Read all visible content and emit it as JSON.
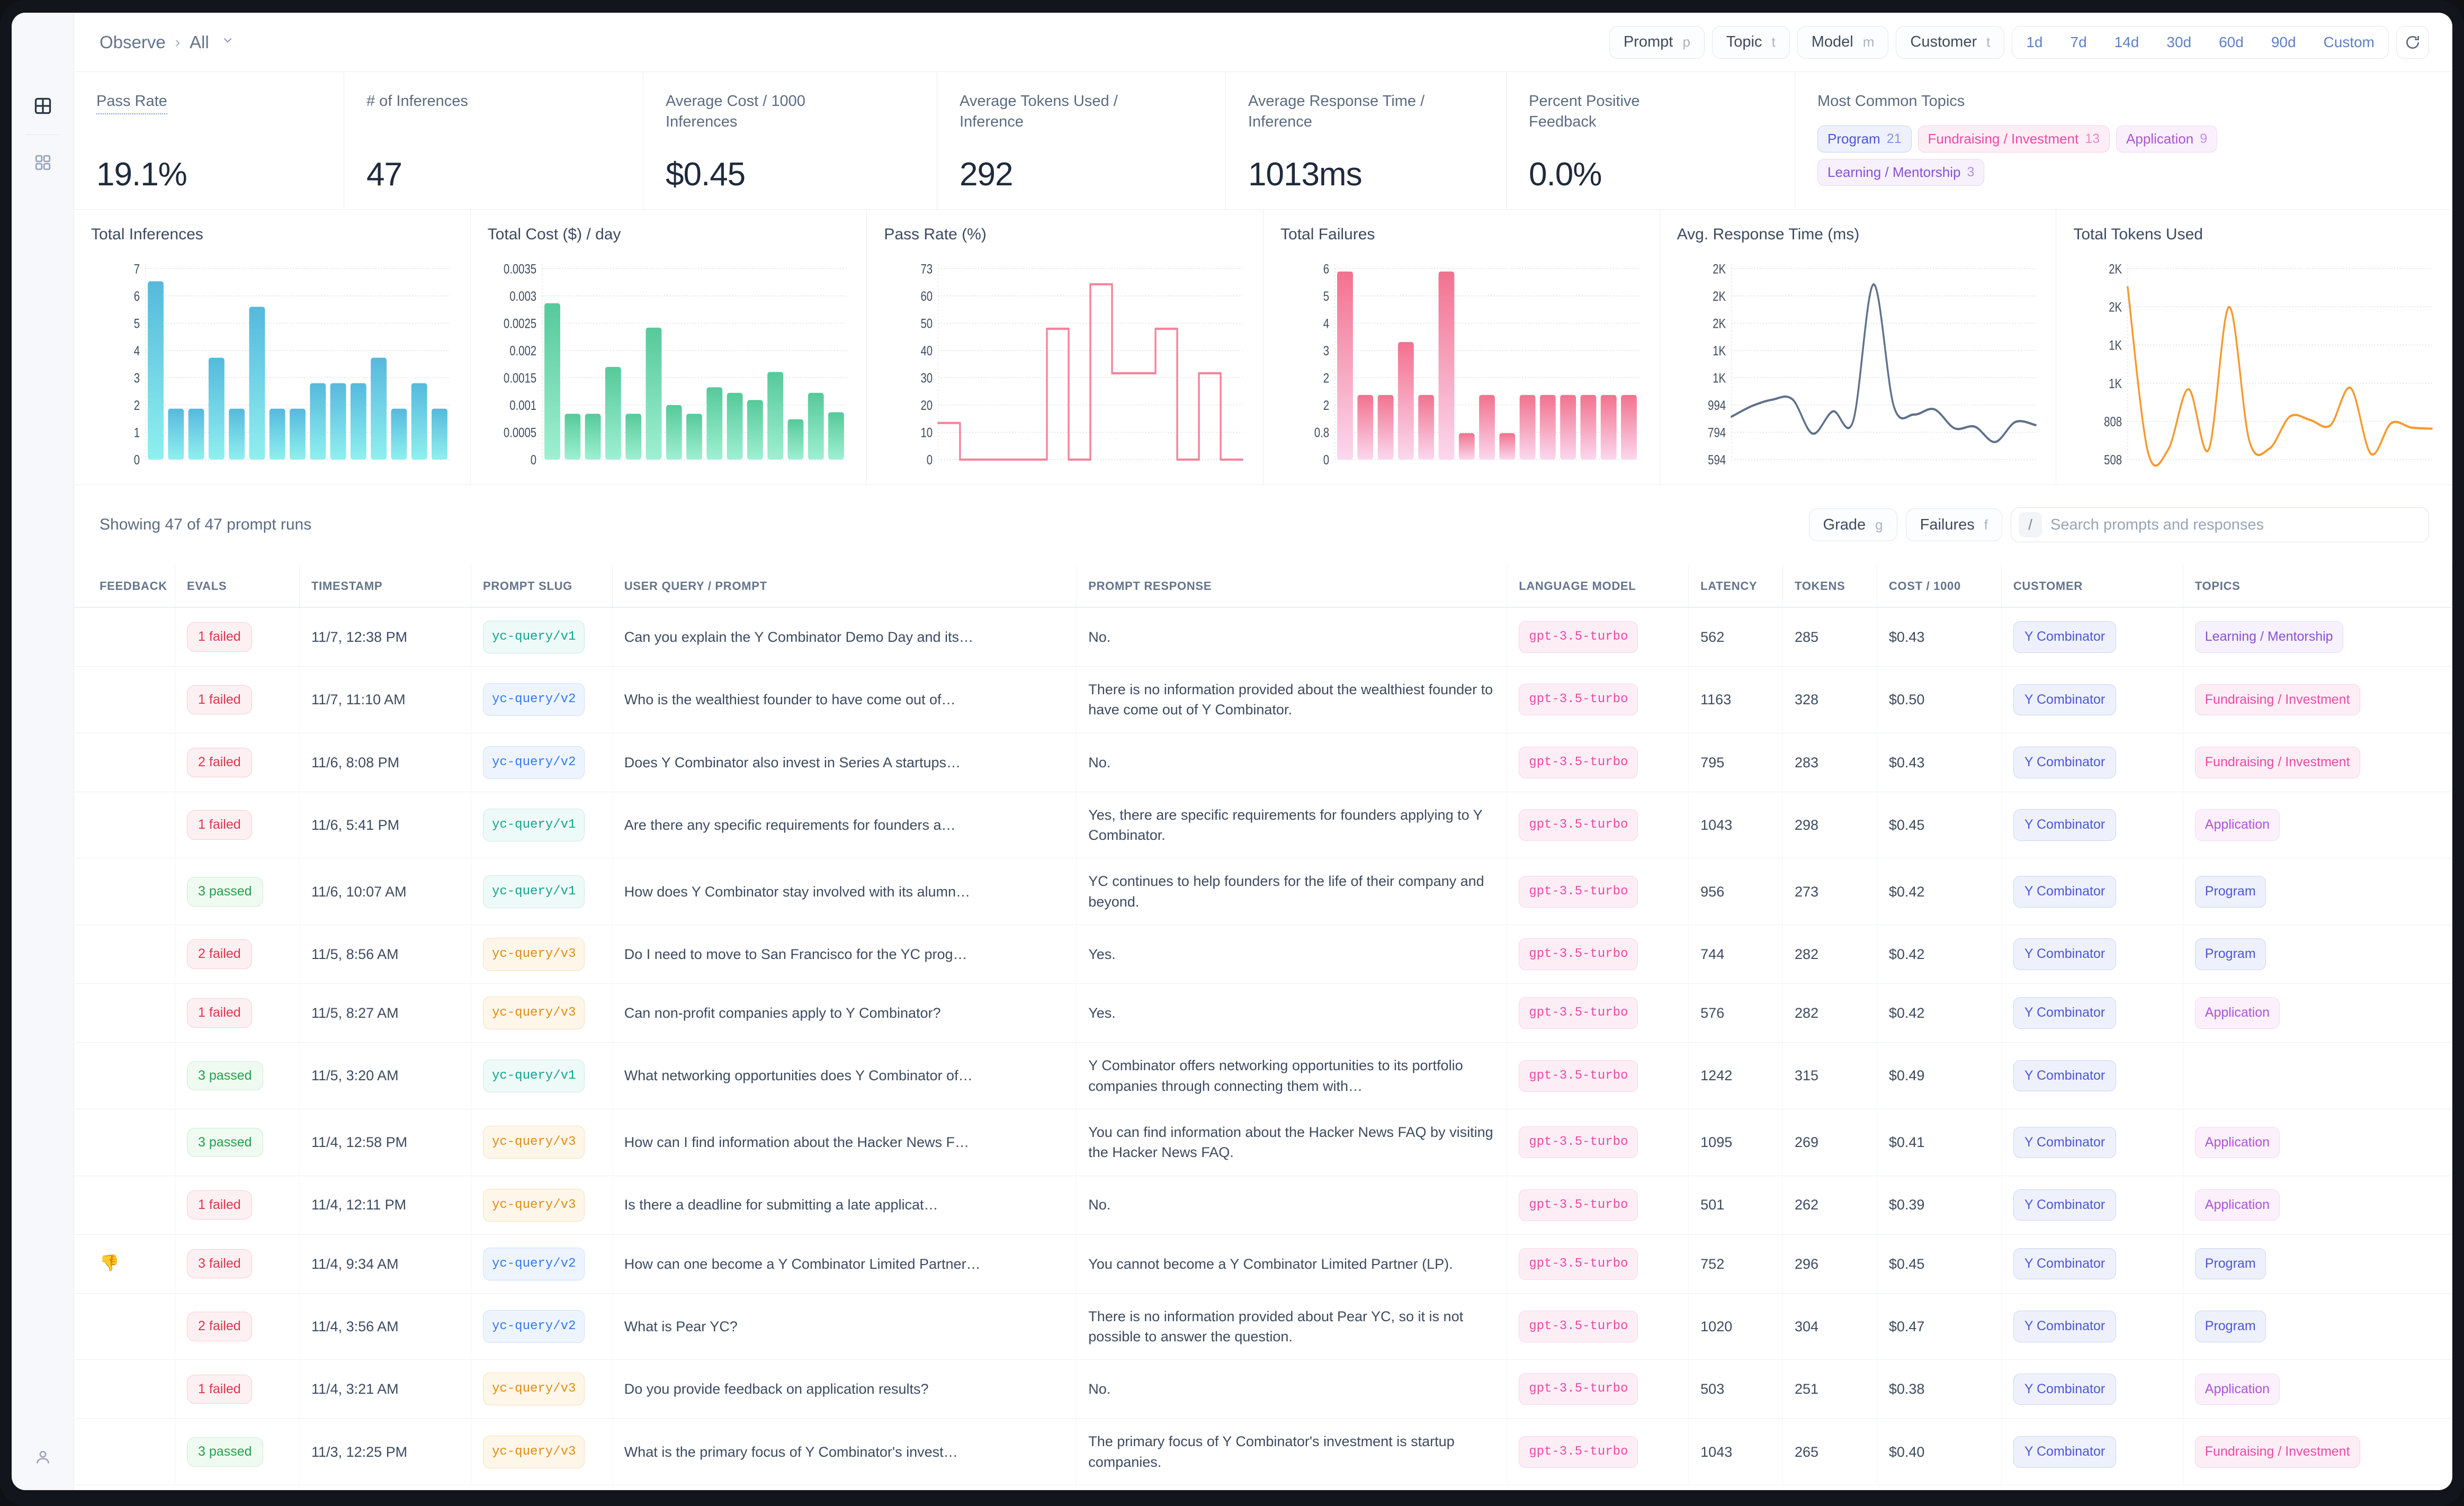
{
  "header": {
    "breadcrumb_root": "Observe",
    "breadcrumb_sep": "›",
    "breadcrumb_current": "All",
    "filters": [
      {
        "label": "Prompt",
        "key": "p"
      },
      {
        "label": "Topic",
        "key": "t"
      },
      {
        "label": "Model",
        "key": "m"
      },
      {
        "label": "Customer",
        "key": "t"
      }
    ],
    "ranges": [
      "1d",
      "7d",
      "14d",
      "30d",
      "60d",
      "90d",
      "Custom"
    ],
    "refresh_icon": "refresh-icon"
  },
  "rail": {
    "items": [
      {
        "icon": "dashboard-grid-icon",
        "active": true
      },
      {
        "icon": "apps-grid-icon",
        "active": false
      }
    ],
    "bottom": {
      "icon": "user-account-icon"
    }
  },
  "kpis": [
    {
      "label": "Pass Rate",
      "value": "19.1%",
      "dotted": true
    },
    {
      "label": "# of Inferences",
      "value": "47",
      "dotted": false
    },
    {
      "label": "Average Cost / 1000 Inferences",
      "value": "$0.45",
      "dotted": false
    },
    {
      "label": "Average Tokens Used / Inference",
      "value": "292",
      "dotted": false
    },
    {
      "label": "Average Response Time / Inference",
      "value": "1013ms",
      "dotted": false
    },
    {
      "label": "Percent Positive Feedback",
      "value": "0.0%",
      "dotted": false
    }
  ],
  "topics_card": {
    "label": "Most Common Topics",
    "chips": [
      {
        "name": "Program",
        "count": "21",
        "color": "blue"
      },
      {
        "name": "Fundraising / Investment",
        "count": "13",
        "color": "pink"
      },
      {
        "name": "Application",
        "count": "9",
        "color": "violet"
      },
      {
        "name": "Learning / Mentorship",
        "count": "3",
        "color": "purple"
      }
    ]
  },
  "chart_data": [
    {
      "type": "bar",
      "title": "Total Inferences",
      "xlabel": "",
      "ylabel": "",
      "yticks": [
        "0",
        "1",
        "2",
        "3",
        "4",
        "5",
        "6",
        "7"
      ],
      "ylim": [
        0,
        7.5
      ],
      "grid": true,
      "color": "#56b9dd",
      "color2": "#8ff0ef",
      "categories": [
        "d1",
        "d2",
        "d3",
        "d4",
        "d5",
        "d6",
        "d7",
        "d8",
        "d9",
        "d10",
        "d11",
        "d12",
        "d13",
        "d14",
        "d15"
      ],
      "values": [
        7,
        2,
        2,
        4,
        2,
        6,
        2,
        2,
        3,
        3,
        3,
        4,
        2,
        3,
        2
      ]
    },
    {
      "type": "bar",
      "title": "Total Cost ($) / day",
      "xlabel": "",
      "ylabel": "",
      "yticks": [
        "0",
        "0.0005",
        "0.001",
        "0.0015",
        "0.002",
        "0.0025",
        "0.003",
        "0.0035"
      ],
      "ylim": [
        0,
        0.00375
      ],
      "grid": true,
      "color": "#56c99a",
      "color2": "#9ef0d2",
      "categories": [
        "d1",
        "d2",
        "d3",
        "d4",
        "d5",
        "d6",
        "d7",
        "d8",
        "d9",
        "d10",
        "d11",
        "d12",
        "d13",
        "d14",
        "d15"
      ],
      "values": [
        0.00307,
        0.0009,
        0.0009,
        0.00182,
        0.0009,
        0.00259,
        0.00107,
        0.0009,
        0.00142,
        0.00131,
        0.00117,
        0.00172,
        0.00079,
        0.00131,
        0.00093
      ]
    },
    {
      "type": "line",
      "title": "Pass Rate (%)",
      "step": true,
      "xlabel": "",
      "ylabel": "",
      "yticks": [
        "0",
        "10",
        "20",
        "30",
        "40",
        "50",
        "60",
        "73"
      ],
      "ylim": [
        0,
        73
      ],
      "grid": true,
      "color": "#f5849c",
      "categories": [
        "d1",
        "d2",
        "d3",
        "d4",
        "d5",
        "d6",
        "d7",
        "d8",
        "d9",
        "d10",
        "d11",
        "d12",
        "d13",
        "d14"
      ],
      "values": [
        14,
        0,
        0,
        0,
        0,
        50,
        0,
        67,
        33,
        33,
        50,
        0,
        33,
        0
      ]
    },
    {
      "type": "bar",
      "title": "Total Failures",
      "xlabel": "",
      "ylabel": "",
      "yticks": [
        "0",
        "0.8",
        "2",
        "2",
        "3",
        "4",
        "5",
        "6"
      ],
      "ylim": [
        0,
        6.5
      ],
      "grid": true,
      "color": "#f2728f",
      "color2": "#fbd8ee",
      "categories": [
        "d1",
        "d2",
        "d3",
        "d4",
        "d5",
        "d6",
        "d7",
        "d8",
        "d9",
        "d10",
        "d11",
        "d12",
        "d13",
        "d14",
        "d15"
      ],
      "values": [
        6.4,
        2.2,
        2.2,
        4,
        2.2,
        6.4,
        0.9,
        2.2,
        0.9,
        2.2,
        2.2,
        2.2,
        2.2,
        2.2,
        2.2
      ]
    },
    {
      "type": "line",
      "title": "Avg. Response Time (ms)",
      "xlabel": "",
      "ylabel": "",
      "yticks": [
        "594",
        "794",
        "994",
        "1K",
        "1K",
        "2K",
        "2K",
        "2K"
      ],
      "ylim": [
        594,
        2400
      ],
      "grid": true,
      "color": "#5f7189",
      "categories": [
        "d1",
        "d2",
        "d3",
        "d4",
        "d5",
        "d6",
        "d7",
        "d8",
        "d9",
        "d10",
        "d11",
        "d12",
        "d13",
        "d14",
        "d15",
        "d16"
      ],
      "values": [
        1000,
        1100,
        1160,
        1165,
        840,
        1050,
        960,
        2250,
        1100,
        1020,
        1070,
        890,
        905,
        760,
        950,
        920
      ]
    },
    {
      "type": "line",
      "title": "Total Tokens Used",
      "xlabel": "",
      "ylabel": "",
      "yticks": [
        "508",
        "808",
        "1K",
        "1K",
        "2K",
        "2K"
      ],
      "ylim": [
        508,
        2250
      ],
      "grid": true,
      "color": "#f59a2e",
      "categories": [
        "d1",
        "d2",
        "d3",
        "d4",
        "d5",
        "d6",
        "d7",
        "d8",
        "d9",
        "d10",
        "d11",
        "d12",
        "d13",
        "d14",
        "d15",
        "d16"
      ],
      "values": [
        2080,
        580,
        600,
        1150,
        600,
        1900,
        680,
        610,
        900,
        870,
        820,
        1160,
        560,
        840,
        800,
        790
      ]
    }
  ],
  "table_toolbar": {
    "showing": "Showing 47 of 47 prompt runs",
    "grade_label": "Grade",
    "grade_key": "g",
    "failures_label": "Failures",
    "failures_key": "f",
    "slash_key": "/",
    "search_placeholder": "Search prompts and responses",
    "search_value": ""
  },
  "table": {
    "columns": [
      "FEEDBACK",
      "EVALS",
      "TIMESTAMP",
      "PROMPT SLUG",
      "USER QUERY / PROMPT",
      "PROMPT RESPONSE",
      "LANGUAGE MODEL",
      "LATENCY",
      "TOKENS",
      "COST / 1000",
      "CUSTOMER",
      "TOPICS"
    ],
    "rows": [
      {
        "feedback": "",
        "evals": "1 failed",
        "evals_type": "fail",
        "timestamp": "11/7, 12:38 PM",
        "slug": "yc-query/v1",
        "slug_ver": "v1",
        "query": "Can you explain the Y Combinator Demo Day and its…",
        "response": "No.",
        "model": "gpt-3.5-turbo",
        "latency": "562",
        "tokens": "285",
        "cost": "$0.43",
        "customer": "Y Combinator",
        "topic": "Learning / Mentorship",
        "topic_class": "Learning"
      },
      {
        "feedback": "",
        "evals": "1 failed",
        "evals_type": "fail",
        "timestamp": "11/7, 11:10 AM",
        "slug": "yc-query/v2",
        "slug_ver": "v2",
        "query": "Who is the wealthiest founder to have come out of…",
        "response": "There is no information provided about the wealthiest founder to have come out of Y Combinator.",
        "model": "gpt-3.5-turbo",
        "latency": "1163",
        "tokens": "328",
        "cost": "$0.50",
        "customer": "Y Combinator",
        "topic": "Fundraising / Investment",
        "topic_class": "Fundraising"
      },
      {
        "feedback": "",
        "evals": "2 failed",
        "evals_type": "fail",
        "timestamp": "11/6, 8:08 PM",
        "slug": "yc-query/v2",
        "slug_ver": "v2",
        "query": "Does Y Combinator also invest in Series A startups…",
        "response": "No.",
        "model": "gpt-3.5-turbo",
        "latency": "795",
        "tokens": "283",
        "cost": "$0.43",
        "customer": "Y Combinator",
        "topic": "Fundraising / Investment",
        "topic_class": "Fundraising"
      },
      {
        "feedback": "",
        "evals": "1 failed",
        "evals_type": "fail",
        "timestamp": "11/6, 5:41 PM",
        "slug": "yc-query/v1",
        "slug_ver": "v1",
        "query": "Are there any specific requirements for founders a…",
        "response": "Yes, there are specific requirements for founders applying to Y Combinator.",
        "model": "gpt-3.5-turbo",
        "latency": "1043",
        "tokens": "298",
        "cost": "$0.45",
        "customer": "Y Combinator",
        "topic": "Application",
        "topic_class": "Application"
      },
      {
        "feedback": "",
        "evals": "3 passed",
        "evals_type": "pass",
        "timestamp": "11/6, 10:07 AM",
        "slug": "yc-query/v1",
        "slug_ver": "v1",
        "query": "How does Y Combinator stay involved with its alumn…",
        "response": "YC continues to help founders for the life of their company and beyond.",
        "model": "gpt-3.5-turbo",
        "latency": "956",
        "tokens": "273",
        "cost": "$0.42",
        "customer": "Y Combinator",
        "topic": "Program",
        "topic_class": "Program"
      },
      {
        "feedback": "",
        "evals": "2 failed",
        "evals_type": "fail",
        "timestamp": "11/5, 8:56 AM",
        "slug": "yc-query/v3",
        "slug_ver": "v3",
        "query": "Do I need to move to San Francisco for the YC prog…",
        "response": "Yes.",
        "model": "gpt-3.5-turbo",
        "latency": "744",
        "tokens": "282",
        "cost": "$0.42",
        "customer": "Y Combinator",
        "topic": "Program",
        "topic_class": "Program"
      },
      {
        "feedback": "",
        "evals": "1 failed",
        "evals_type": "fail",
        "timestamp": "11/5, 8:27 AM",
        "slug": "yc-query/v3",
        "slug_ver": "v3",
        "query": "Can non-profit companies apply to Y Combinator?",
        "response": "Yes.",
        "model": "gpt-3.5-turbo",
        "latency": "576",
        "tokens": "282",
        "cost": "$0.42",
        "customer": "Y Combinator",
        "topic": "Application",
        "topic_class": "Application"
      },
      {
        "feedback": "",
        "evals": "3 passed",
        "evals_type": "pass",
        "timestamp": "11/5, 3:20 AM",
        "slug": "yc-query/v1",
        "slug_ver": "v1",
        "query": "What networking opportunities does Y Combinator of…",
        "response": "Y Combinator offers networking opportunities to its portfolio companies through connecting them with…",
        "model": "gpt-3.5-turbo",
        "latency": "1242",
        "tokens": "315",
        "cost": "$0.49",
        "customer": "Y Combinator",
        "topic": "",
        "topic_class": ""
      },
      {
        "feedback": "",
        "evals": "3 passed",
        "evals_type": "pass",
        "timestamp": "11/4, 12:58 PM",
        "slug": "yc-query/v3",
        "slug_ver": "v3",
        "query": "How can I find information about the Hacker News F…",
        "response": "You can find information about the Hacker News FAQ by visiting the Hacker News FAQ.",
        "model": "gpt-3.5-turbo",
        "latency": "1095",
        "tokens": "269",
        "cost": "$0.41",
        "customer": "Y Combinator",
        "topic": "Application",
        "topic_class": "Application"
      },
      {
        "feedback": "",
        "evals": "1 failed",
        "evals_type": "fail",
        "timestamp": "11/4, 12:11 PM",
        "slug": "yc-query/v3",
        "slug_ver": "v3",
        "query": "Is there a deadline for submitting a late applicat…",
        "response": "No.",
        "model": "gpt-3.5-turbo",
        "latency": "501",
        "tokens": "262",
        "cost": "$0.39",
        "customer": "Y Combinator",
        "topic": "Application",
        "topic_class": "Application"
      },
      {
        "feedback": "👎",
        "evals": "3 failed",
        "evals_type": "fail",
        "timestamp": "11/4, 9:34 AM",
        "slug": "yc-query/v2",
        "slug_ver": "v2",
        "query": "How can one become a Y Combinator Limited Partner…",
        "response": "You cannot become a Y Combinator Limited Partner (LP).",
        "model": "gpt-3.5-turbo",
        "latency": "752",
        "tokens": "296",
        "cost": "$0.45",
        "customer": "Y Combinator",
        "topic": "Program",
        "topic_class": "Program"
      },
      {
        "feedback": "",
        "evals": "2 failed",
        "evals_type": "fail",
        "timestamp": "11/4, 3:56 AM",
        "slug": "yc-query/v2",
        "slug_ver": "v2",
        "query": "What is Pear YC?",
        "response": "There is no information provided about Pear YC, so it is not possible to answer the question.",
        "model": "gpt-3.5-turbo",
        "latency": "1020",
        "tokens": "304",
        "cost": "$0.47",
        "customer": "Y Combinator",
        "topic": "Program",
        "topic_class": "Program"
      },
      {
        "feedback": "",
        "evals": "1 failed",
        "evals_type": "fail",
        "timestamp": "11/4, 3:21 AM",
        "slug": "yc-query/v3",
        "slug_ver": "v3",
        "query": "Do you provide feedback on application results?",
        "response": "No.",
        "model": "gpt-3.5-turbo",
        "latency": "503",
        "tokens": "251",
        "cost": "$0.38",
        "customer": "Y Combinator",
        "topic": "Application",
        "topic_class": "Application"
      },
      {
        "feedback": "",
        "evals": "3 passed",
        "evals_type": "pass",
        "timestamp": "11/3, 12:25 PM",
        "slug": "yc-query/v3",
        "slug_ver": "v3",
        "query": "What is the primary focus of Y Combinator's invest…",
        "response": "The primary focus of Y Combinator's investment is startup companies.",
        "model": "gpt-3.5-turbo",
        "latency": "1043",
        "tokens": "265",
        "cost": "$0.40",
        "customer": "Y Combinator",
        "topic": "Fundraising / Investment",
        "topic_class": "Fundraising"
      }
    ]
  }
}
